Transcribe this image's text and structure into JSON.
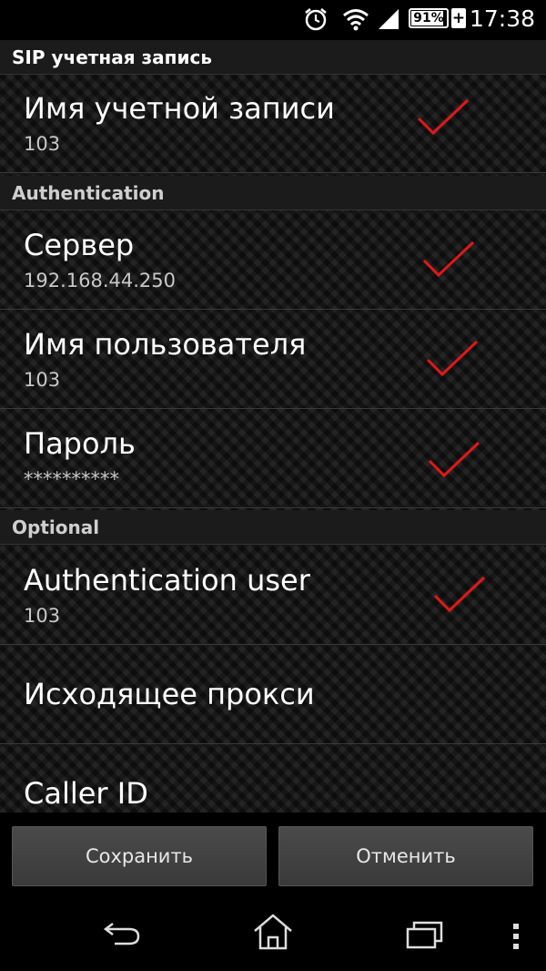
{
  "status_bar": {
    "time": "17:38",
    "battery_percent": "91%",
    "battery_level": 0.91,
    "icons": [
      "alarm-icon",
      "wifi-icon",
      "signal-icon",
      "battery-icon",
      "charging-plus-icon"
    ]
  },
  "sections": {
    "sip_account": "SIP учетная запись",
    "authentication": "Authentication",
    "optional": "Optional"
  },
  "prefs": {
    "account_name": {
      "title": "Имя учетной записи",
      "summary": "103"
    },
    "server": {
      "title": "Сервер",
      "summary": "192.168.44.250"
    },
    "username": {
      "title": "Имя пользователя",
      "summary": "103"
    },
    "password": {
      "title": "Пароль",
      "summary": "**********"
    },
    "auth_user": {
      "title": "Authentication user",
      "summary": "103"
    },
    "outbound_proxy": {
      "title": "Исходящее прокси"
    },
    "caller_id": {
      "title": "Caller ID"
    }
  },
  "buttons": {
    "save": "Сохранить",
    "cancel": "Отменить"
  },
  "nav": {
    "icons": [
      "back-icon",
      "home-icon",
      "recent-apps-icon",
      "overflow-menu-icon"
    ]
  },
  "colors": {
    "checkmark": "#e01818"
  }
}
